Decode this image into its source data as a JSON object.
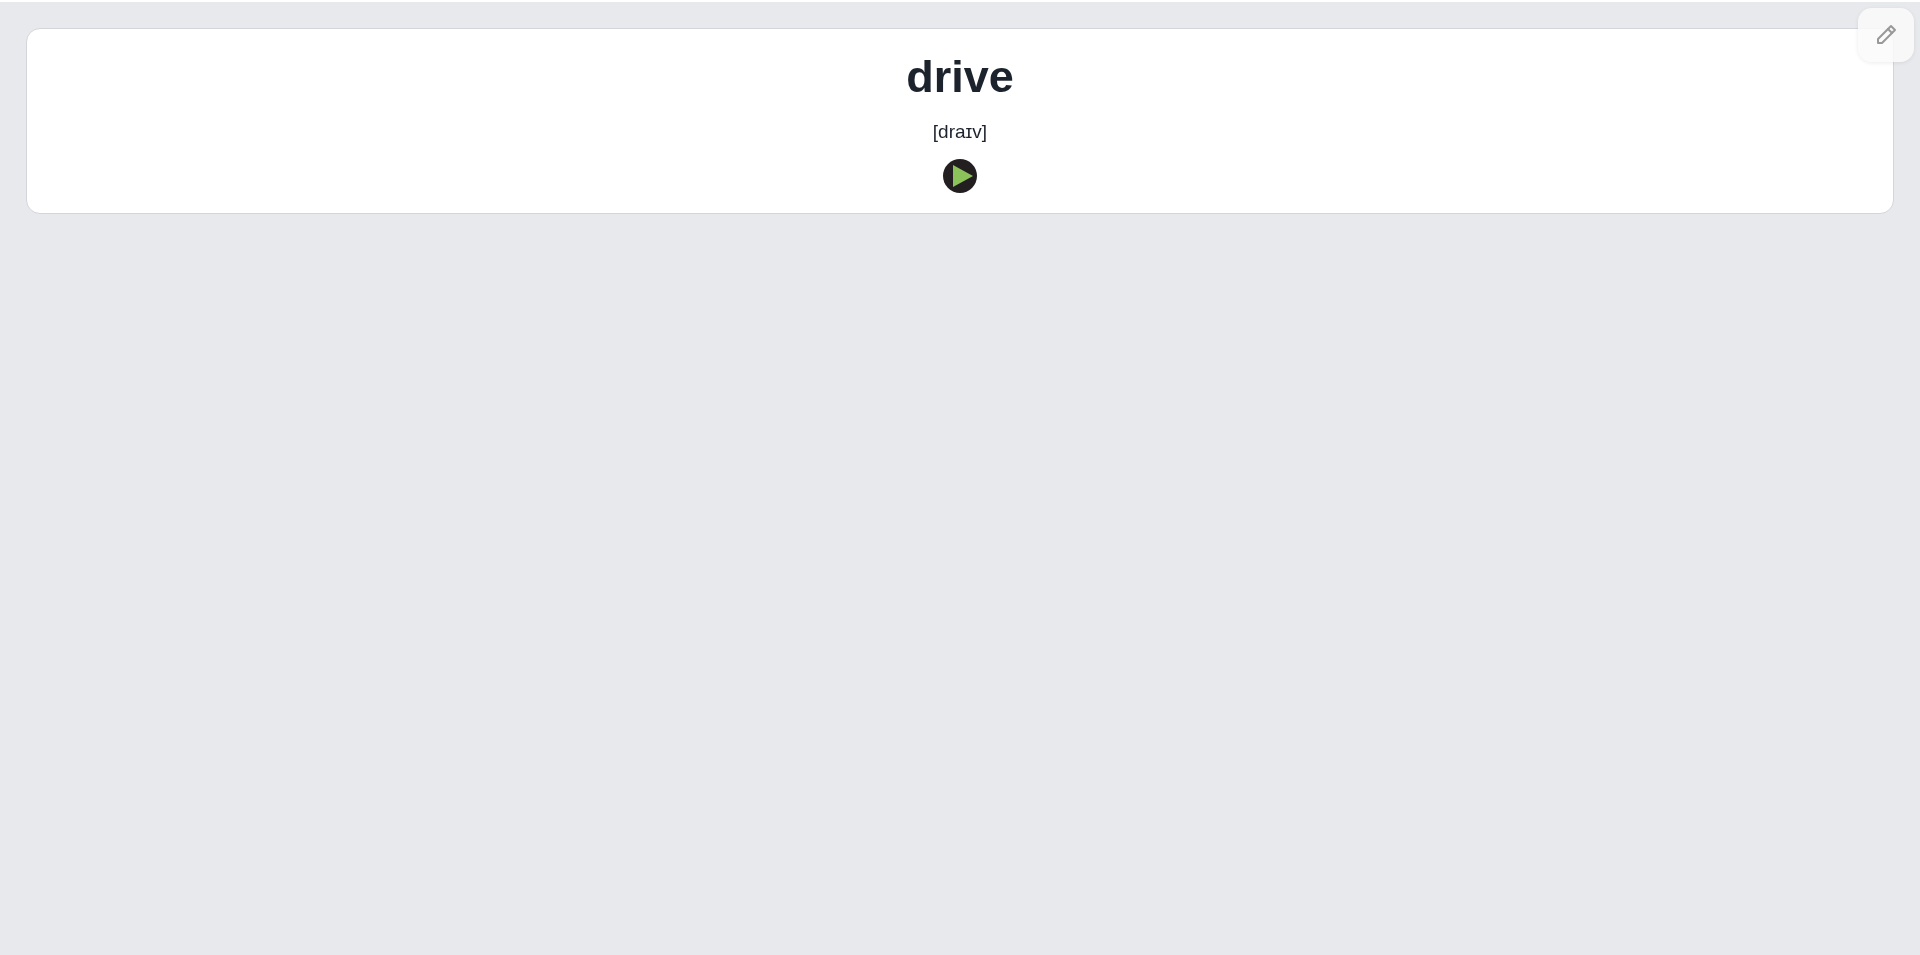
{
  "word": "drive",
  "transcription": "[draɪv]"
}
